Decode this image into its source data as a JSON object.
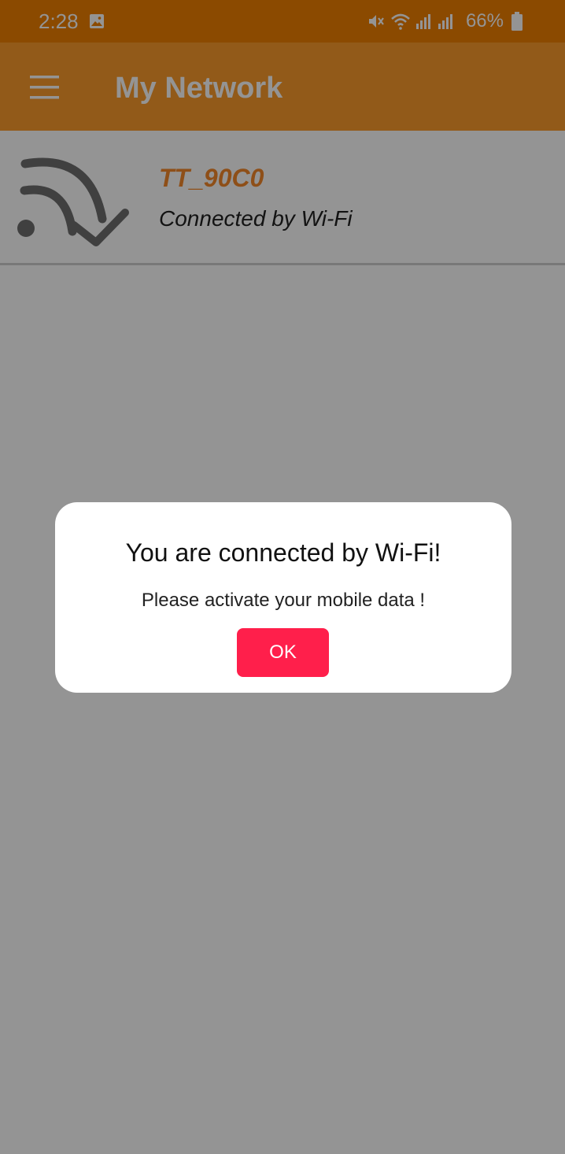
{
  "status_bar": {
    "time": "2:28",
    "battery": "66%",
    "background": "#f08000",
    "icons": [
      "gallery-icon",
      "mute-icon",
      "wifi-icon",
      "signal-icon",
      "signal-icon",
      "battery-icon"
    ]
  },
  "app_bar": {
    "title": "My Network",
    "menu_icon": "menu-icon",
    "background": "#fb9b2b"
  },
  "network": {
    "name": "TT_90C0",
    "status": "Connected by Wi-Fi",
    "icon": "wifi-connected-icon",
    "name_color": "#f5882a"
  },
  "dialog": {
    "title": "You are connected by Wi-Fi!",
    "message": "Please activate your mobile data !",
    "ok_label": "OK",
    "ok_color": "#ff1f4b"
  }
}
